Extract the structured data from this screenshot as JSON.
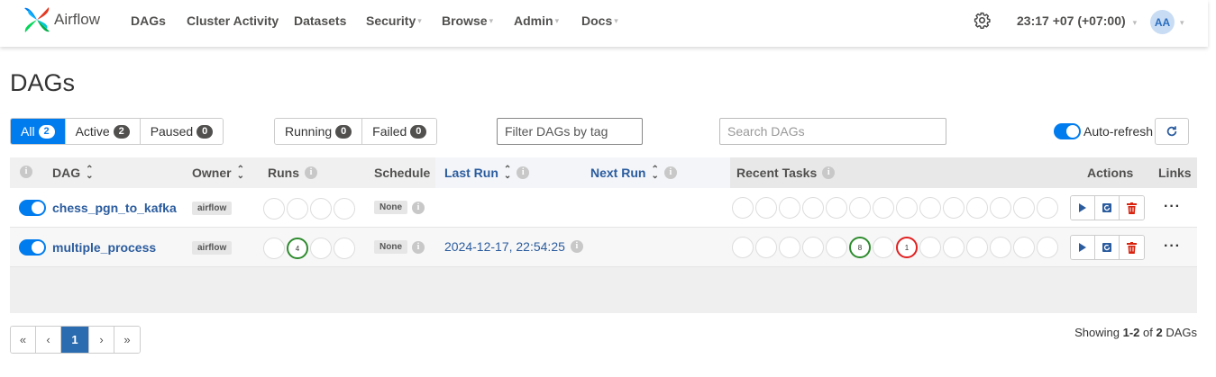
{
  "navbar": {
    "brand": "Airflow",
    "items": [
      {
        "label": "DAGs",
        "dropdown": false
      },
      {
        "label": "Cluster Activity",
        "dropdown": false
      },
      {
        "label": "Datasets",
        "dropdown": false
      },
      {
        "label": "Security",
        "dropdown": true
      },
      {
        "label": "Browse",
        "dropdown": true
      },
      {
        "label": "Admin",
        "dropdown": true
      },
      {
        "label": "Docs",
        "dropdown": true
      }
    ],
    "clock": "23:17 +07 (+07:00)",
    "avatar": "AA"
  },
  "page_title": "DAGs",
  "status_filters": [
    {
      "label": "All",
      "count": "2",
      "active": true
    },
    {
      "label": "Active",
      "count": "2",
      "active": false
    },
    {
      "label": "Paused",
      "count": "0",
      "active": false
    }
  ],
  "run_filters": [
    {
      "label": "Running",
      "count": "0"
    },
    {
      "label": "Failed",
      "count": "0"
    }
  ],
  "tag_filter_placeholder": "Filter DAGs by tag",
  "search_placeholder": "Search DAGs",
  "auto_refresh_label": "Auto-refresh",
  "table": {
    "headers": {
      "dag": "DAG",
      "owner": "Owner",
      "runs": "Runs",
      "schedule": "Schedule",
      "last_run": "Last Run",
      "next_run": "Next Run",
      "recent_tasks": "Recent Tasks",
      "actions": "Actions",
      "links": "Links"
    },
    "rows": [
      {
        "dag_id": "chess_pgn_to_kafka",
        "owner": "airflow",
        "schedule": "None",
        "last_run": "",
        "runs": [
          "",
          "",
          "",
          ""
        ],
        "recent_tasks": [
          "",
          "",
          "",
          "",
          "",
          "",
          "",
          "",
          "",
          "",
          "",
          "",
          "",
          ""
        ]
      },
      {
        "dag_id": "multiple_process",
        "owner": "airflow",
        "schedule": "None",
        "last_run": "2024-12-17, 22:54:25",
        "runs": [
          "",
          "4",
          "",
          ""
        ],
        "recent_tasks": [
          "",
          "",
          "",
          "",
          "",
          "8",
          "",
          "1",
          "",
          "",
          "",
          "",
          "",
          ""
        ]
      }
    ]
  },
  "pagination": {
    "first": "«",
    "prev": "‹",
    "current": "1",
    "next": "›",
    "last": "»"
  },
  "showing": {
    "prefix": "Showing ",
    "range": "1-2",
    "of": " of ",
    "total": "2",
    "suffix": " DAGs"
  },
  "colors": {
    "primary": "#017cee",
    "success": "#2e8b2e",
    "failed": "#e02020",
    "link": "#2b5c9e"
  }
}
